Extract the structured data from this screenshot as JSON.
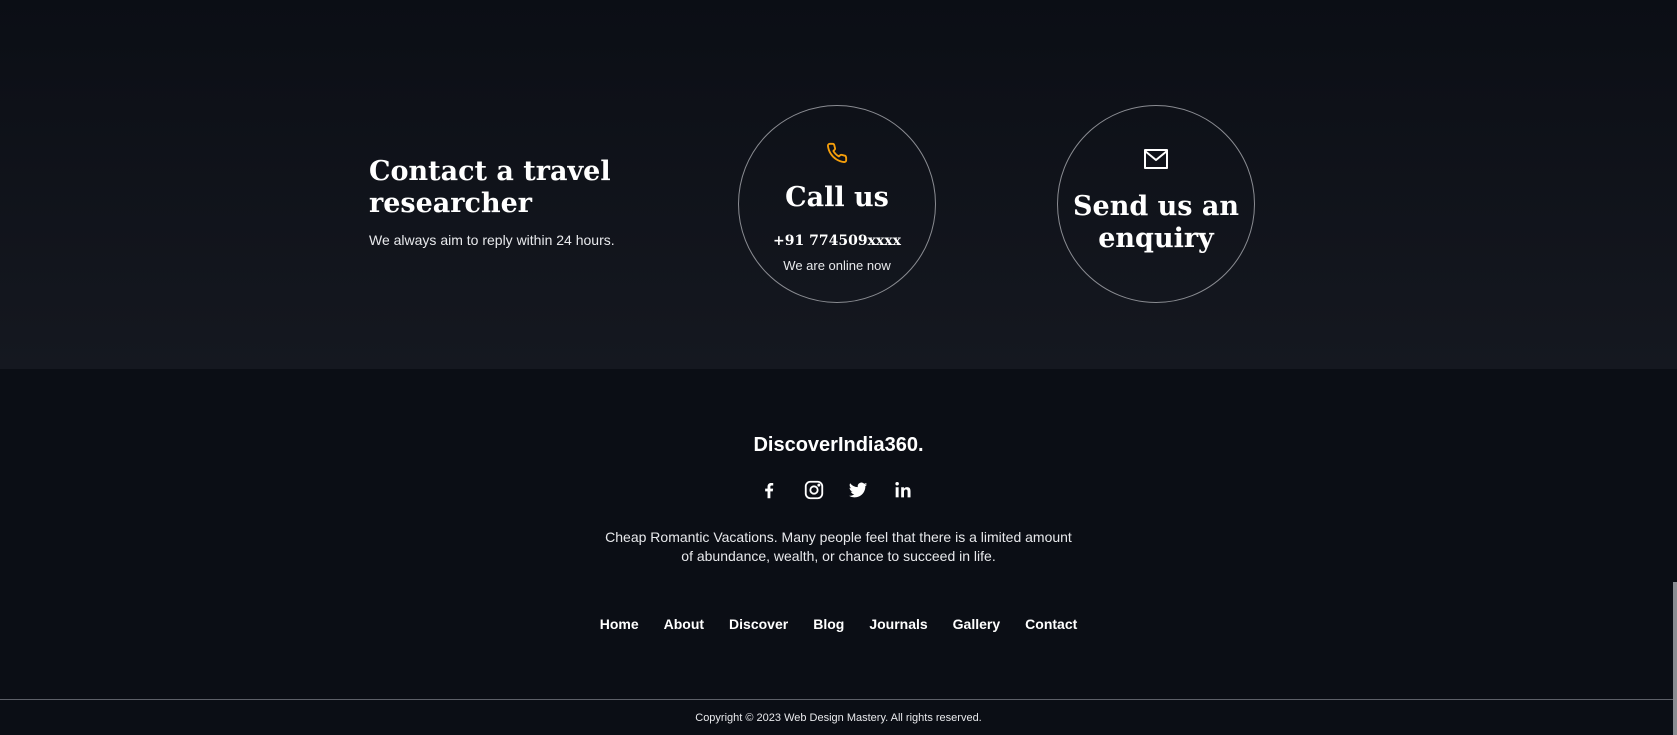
{
  "contact": {
    "heading": "Contact a travel researcher",
    "subtext": "We always aim to reply within 24 hours.",
    "call": {
      "title": "Call us",
      "phone": "+91 774509xxxx",
      "status": "We are online now",
      "icon": "phone-icon",
      "icon_color": "#f59e0b"
    },
    "enquiry": {
      "title": "Send us an enquiry",
      "icon": "mail-icon"
    }
  },
  "footer": {
    "brand": "DiscoverIndia360.",
    "socials": [
      "facebook-icon",
      "instagram-icon",
      "twitter-icon",
      "linkedin-icon"
    ],
    "tagline": "Cheap Romantic Vacations. Many people feel that there is a limited amount of abundance, wealth, or chance to succeed in life.",
    "nav": [
      "Home",
      "About",
      "Discover",
      "Blog",
      "Journals",
      "Gallery",
      "Contact"
    ],
    "copyright": "Copyright © 2023 Web Design Mastery. All rights reserved."
  },
  "colors": {
    "background": "#0b0e15",
    "accent": "#f59e0b",
    "circle_border": "#8a8c92"
  }
}
